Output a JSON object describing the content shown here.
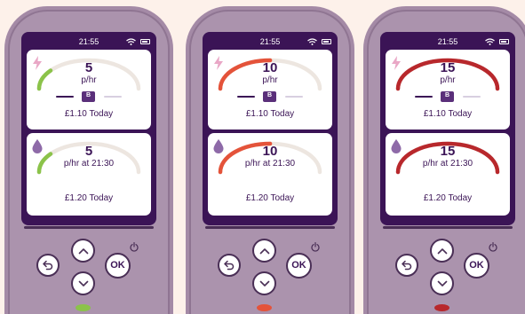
{
  "devices": [
    {
      "clock": "21:55",
      "accent": "#8bc34a",
      "electricity": {
        "value": "5",
        "unit": "p/hr",
        "badge": "B",
        "today": "£1.10 Today",
        "level": 0.18
      },
      "gas": {
        "value": "5",
        "unit": "p/hr at 21:30",
        "today": "£1.20 Today",
        "level": 0.18
      },
      "ok_label": "OK",
      "led_color": "#8bc34a"
    },
    {
      "clock": "21:55",
      "accent": "#e4533a",
      "electricity": {
        "value": "10",
        "unit": "p/hr",
        "badge": "B",
        "today": "£1.10 Today",
        "level": 0.5
      },
      "gas": {
        "value": "10",
        "unit": "p/hr at 21:30",
        "today": "£1.20 Today",
        "level": 0.5
      },
      "ok_label": "OK",
      "led_color": "#e4533a"
    },
    {
      "clock": "21:55",
      "accent": "#b8282c",
      "electricity": {
        "value": "15",
        "unit": "p/hr",
        "badge": "B",
        "today": "£1.10 Today",
        "level": 1.0
      },
      "gas": {
        "value": "15",
        "unit": "p/hr at 21:30",
        "today": "£1.20 Today",
        "level": 1.0
      },
      "ok_label": "OK",
      "led_color": "#b8282c"
    }
  ],
  "icons": {
    "status": [
      "wifi-icon",
      "battery-icon"
    ],
    "electricity": "lightning-icon",
    "gas": "flame-drop-icon",
    "buttons": [
      "chevron-up-icon",
      "back-arrow-icon",
      "chevron-down-icon",
      "power-icon"
    ]
  },
  "colors": {
    "screen": "#3b1456",
    "device": "#ab93ad",
    "track": "#ede6e0",
    "elec_icon": "#e9a7c6",
    "gas_icon": "#8e6aa8"
  }
}
